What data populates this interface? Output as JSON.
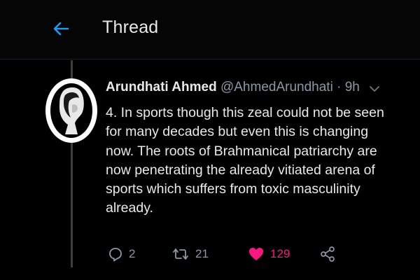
{
  "header": {
    "title": "Thread",
    "back_icon": "arrow-left-icon"
  },
  "tweet": {
    "author_name": "Arundhati Ahmed",
    "author_handle": "@AhmedArundhati",
    "separator": "·",
    "timestamp": "9h",
    "lines": [
      "4. In sports though this zeal could not be seen",
      "for many decades but even this is changing",
      "now. The roots of Brahmanical patriarchy are",
      "now penetrating the already vitiated arena of",
      "sports which suffers from toxic masculinity",
      "already."
    ]
  },
  "actions": {
    "reply": {
      "icon": "reply-icon",
      "count": "2"
    },
    "retweet": {
      "icon": "retweet-icon",
      "count": "21"
    },
    "like": {
      "icon": "heart-icon",
      "count": "129",
      "liked": true
    },
    "share": {
      "icon": "share-icon"
    }
  },
  "colors": {
    "background": "#000000",
    "text": "#e7e9ea",
    "secondary_text": "#8b98a5",
    "accent_blue": "#1d9bf0",
    "like_pink": "#f91880"
  }
}
